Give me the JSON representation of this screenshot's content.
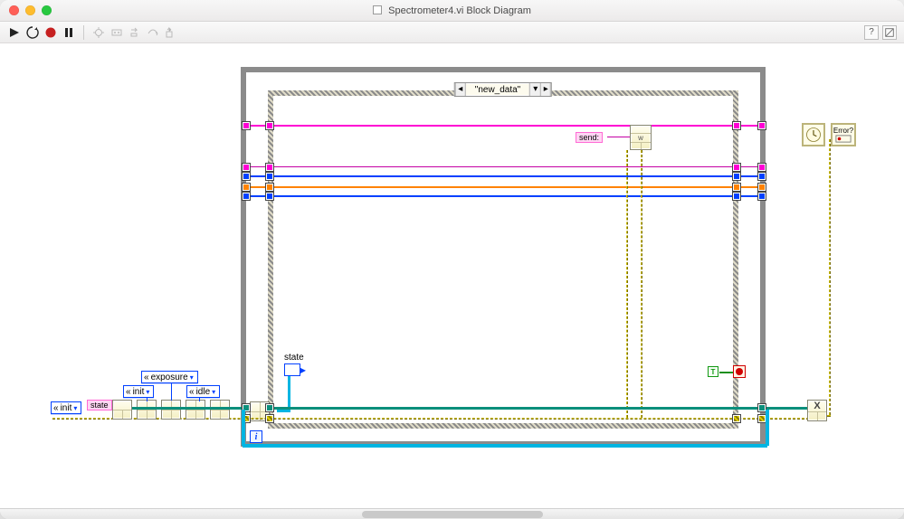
{
  "window": {
    "title": "Spectrometer4.vi Block Diagram"
  },
  "toolbar": {
    "run_label": "Run",
    "runcont_label": "Run Continuously",
    "abort_label": "Abort",
    "pause_label": "Pause",
    "highlight_label": "Highlight Execution",
    "retain_label": "Retain Wire Values",
    "stepinto_label": "Step Into",
    "stepover_label": "Step Over",
    "stepout_label": "Step Out",
    "help_label": "?"
  },
  "case": {
    "current": "\"new_data\"",
    "left_nav": "◂",
    "right_nav": "▸"
  },
  "labels": {
    "state1": "state",
    "state2": "state",
    "send": "send:",
    "init1": "init",
    "init2": "init",
    "exposure": "exposure",
    "idle": "idle"
  },
  "iter": "i",
  "bool_const": "T",
  "subvi": {
    "queue_write": "w",
    "wait": "wait",
    "x_close": "X"
  },
  "right_nodes": {
    "help": "?",
    "error": "Error?"
  }
}
